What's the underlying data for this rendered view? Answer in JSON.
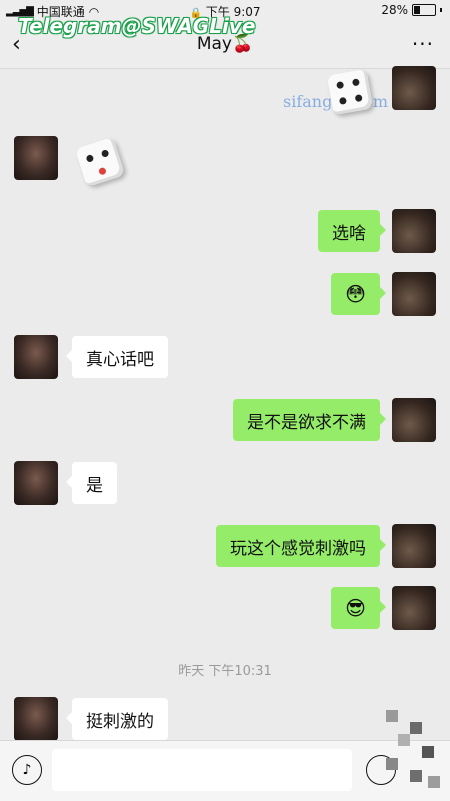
{
  "status_bar": {
    "carrier": "中国联通",
    "time": "下午 9:07",
    "battery": "28%",
    "battery_level": 0.28
  },
  "chat": {
    "title": "May🍒",
    "back_icon": "chevron-left-icon",
    "more_label": "···"
  },
  "watermarks": {
    "top": "Telegram@SWAGLive",
    "middle": "sifangkv.com"
  },
  "messages": [
    {
      "side": "right",
      "type": "dice"
    },
    {
      "side": "left",
      "type": "dice"
    },
    {
      "side": "right",
      "type": "text",
      "text": "选啥"
    },
    {
      "side": "right",
      "type": "emoji",
      "text": "😳"
    },
    {
      "side": "left",
      "type": "text",
      "text": "真心话吧"
    },
    {
      "side": "right",
      "type": "text",
      "text": "是不是欲求不满"
    },
    {
      "side": "left",
      "type": "text",
      "text": "是"
    },
    {
      "side": "right",
      "type": "text",
      "text": "玩这个感觉刺激吗"
    },
    {
      "side": "right",
      "type": "emoji",
      "text": "😎"
    },
    {
      "side": "left",
      "type": "text",
      "text": "挺刺激的"
    }
  ],
  "timestamp": "昨天 下午10:31",
  "input_bar": {
    "voice_icon": "voice-icon",
    "emoji_icon": "emoji-icon"
  },
  "colors": {
    "own_bubble": "#95ec69",
    "other_bubble": "#ffffff",
    "background": "#ebebeb"
  }
}
